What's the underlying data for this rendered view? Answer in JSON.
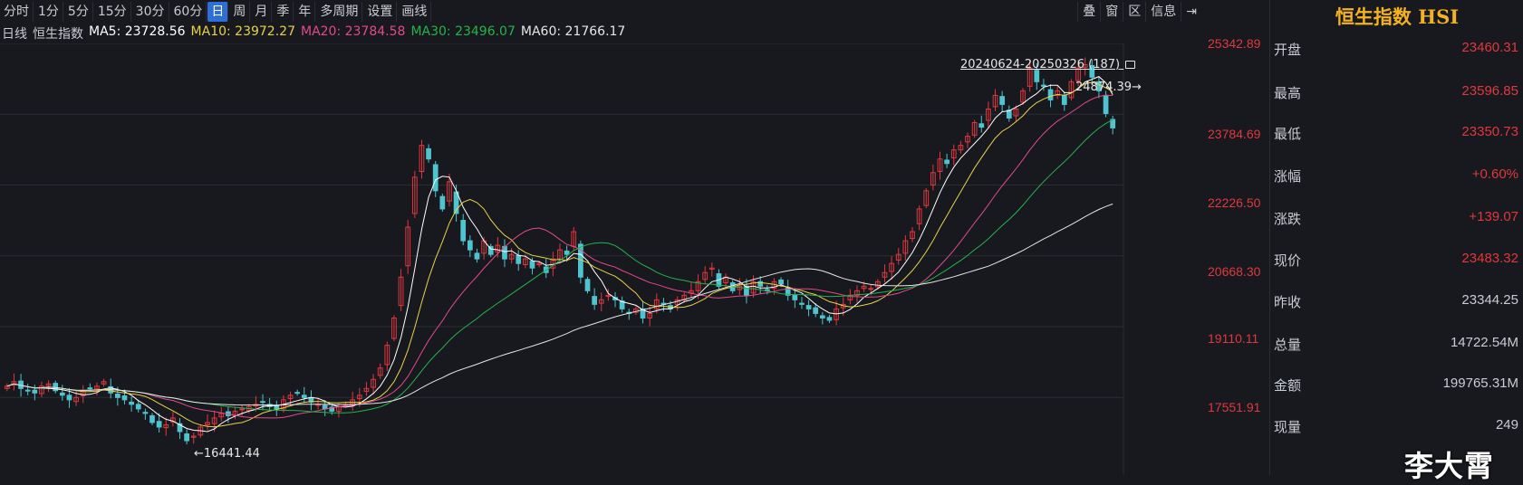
{
  "toolbar": {
    "periods": [
      "分时",
      "1分",
      "5分",
      "15分",
      "30分",
      "60分",
      "日",
      "周",
      "月",
      "季",
      "年",
      "多周期",
      "设置",
      "画线"
    ],
    "active": "日",
    "right_buttons": [
      "叠",
      "窗",
      "区",
      "信息",
      "⇥"
    ]
  },
  "ma": {
    "prefix": "日线",
    "name": "恒生指数",
    "ma5": "MA5: 23728.56",
    "ma10": "MA10: 23972.27",
    "ma20": "MA20: 23784.58",
    "ma30": "MA30: 23496.07",
    "ma60": "MA60: 21766.17"
  },
  "colors": {
    "ma5": "#ffffff",
    "ma10": "#e8d24a",
    "ma20": "#e24a8a",
    "ma30": "#25b34b",
    "ma60": "#e6e6e6",
    "up": "#e0383e",
    "down": "#4fc4cf"
  },
  "yaxis": [
    "25342.89",
    "23784.69",
    "22226.50",
    "20668.30",
    "19110.11",
    "17551.91"
  ],
  "annotations": {
    "range": "20240624-20250326 (187)",
    "high": "24874.39",
    "low": "16441.44"
  },
  "panel": {
    "title": "恒生指数 HSI",
    "rows": [
      {
        "label": "开盘",
        "value": "23460.31"
      },
      {
        "label": "最高",
        "value": "23596.85"
      },
      {
        "label": "最低",
        "value": "23350.73"
      },
      {
        "label": "涨幅",
        "value": "+0.60%"
      },
      {
        "label": "涨跌",
        "value": "+139.07"
      },
      {
        "label": "现价",
        "value": "23483.32"
      },
      {
        "label": "昨收",
        "value": "23344.25"
      },
      {
        "label": "总量",
        "value": "14722.54M"
      },
      {
        "label": "金额",
        "value": "199765.31M"
      },
      {
        "label": "现量",
        "value": "249"
      }
    ]
  },
  "watermark": "李大霄",
  "chart_data": {
    "type": "candlestick",
    "ylim": [
      16441.44,
      25342.89
    ],
    "closes": [
      17800,
      17900,
      17750,
      17700,
      17650,
      17800,
      17850,
      17700,
      17600,
      17500,
      17550,
      17700,
      17750,
      17800,
      17900,
      17650,
      17550,
      17500,
      17400,
      17300,
      17200,
      17000,
      16900,
      16950,
      17100,
      16800,
      16600,
      16700,
      16900,
      17000,
      17100,
      17200,
      17150,
      17250,
      17300,
      17350,
      17400,
      17450,
      17350,
      17300,
      17500,
      17600,
      17650,
      17550,
      17450,
      17400,
      17300,
      17250,
      17350,
      17400,
      17500,
      17600,
      17750,
      17950,
      18200,
      18700,
      19300,
      20200,
      21300,
      22400,
      23100,
      22800,
      22100,
      21700,
      22300,
      21600,
      21000,
      20800,
      20600,
      21000,
      20700,
      20900,
      20600,
      20700,
      20500,
      20600,
      20400,
      20500,
      20300,
      20600,
      20800,
      20700,
      21200,
      20200,
      19900,
      19600,
      19700,
      19800,
      19700,
      19500,
      19400,
      19500,
      19300,
      19400,
      19700,
      19600,
      19500,
      19700,
      19800,
      19900,
      20100,
      20300,
      20400,
      20000,
      20200,
      19900,
      20000,
      19800,
      20100,
      20000,
      19900,
      20100,
      20050,
      19800,
      19700,
      19600,
      19500,
      19400,
      19300,
      19250,
      19500,
      19600,
      19800,
      19900,
      20000,
      19950,
      20100,
      20300,
      20500,
      20700,
      21000,
      21200,
      21700,
      22100,
      22500,
      22800,
      22700,
      23000,
      23100,
      23300,
      23600,
      23500,
      23900,
      24200,
      24000,
      23700,
      23900,
      24300,
      24800,
      24500,
      24400,
      24100,
      24300,
      24000,
      24500,
      24800,
      24874,
      24600,
      24300,
      23800,
      23483
    ]
  }
}
